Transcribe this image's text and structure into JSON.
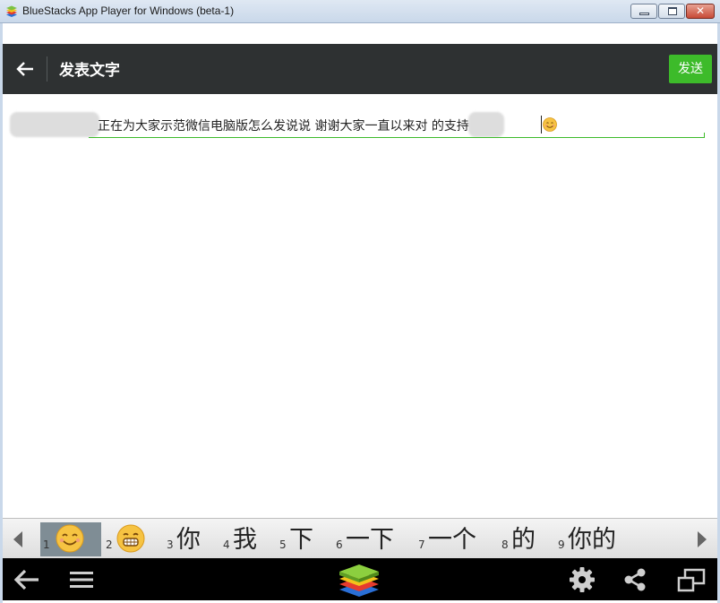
{
  "window": {
    "title": "BlueStacks App Player for Windows (beta-1)",
    "close_label": "✕"
  },
  "header": {
    "title": "发表文字",
    "send_label": "发送"
  },
  "composer": {
    "text": "正在为大家示范微信电脑版怎么发说说  谢谢大家一直以来对    的支持"
  },
  "candidates": [
    {
      "num": "1",
      "text": "",
      "emoji": "smile"
    },
    {
      "num": "2",
      "text": "",
      "emoji": "grin"
    },
    {
      "num": "3",
      "text": "你"
    },
    {
      "num": "4",
      "text": "我"
    },
    {
      "num": "5",
      "text": "下"
    },
    {
      "num": "6",
      "text": "一下"
    },
    {
      "num": "7",
      "text": "一个"
    },
    {
      "num": "8",
      "text": "的"
    },
    {
      "num": "9",
      "text": "你的"
    }
  ],
  "icons": {
    "back": "back-arrow-icon",
    "nav_back": "nav-back-icon",
    "menu": "menu-icon",
    "bluestacks": "bluestacks-logo-icon",
    "settings": "gear-icon",
    "share": "share-icon",
    "window_mode": "window-mode-icon"
  },
  "colors": {
    "header_bg": "#2e3132",
    "accent_green": "#3dbb2a",
    "nav_bg": "#000000"
  }
}
